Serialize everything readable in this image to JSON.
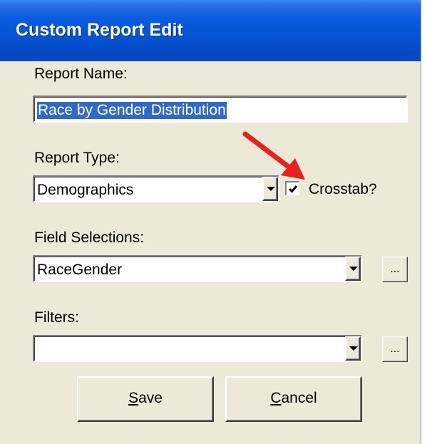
{
  "window": {
    "title": "Custom Report Edit"
  },
  "report_name": {
    "label": "Report Name:",
    "value": "Race by Gender Distribution"
  },
  "report_type": {
    "label": "Report Type:",
    "value": "Demographics"
  },
  "crosstab": {
    "label": "Crosstab?",
    "checked": true
  },
  "field_selections": {
    "label": "Field Selections:",
    "value": "RaceGender",
    "browse_label": "..."
  },
  "filters": {
    "label": "Filters:",
    "value": "",
    "browse_label": "..."
  },
  "buttons": {
    "save": {
      "mnemonic": "S",
      "rest": "ave"
    },
    "cancel": {
      "mnemonic": "C",
      "rest": "ancel"
    }
  },
  "annotation": {
    "arrow_color": "#e82020"
  },
  "colors": {
    "titlebar": "#0654d4",
    "dialog_bg": "#ece9d8",
    "selection": "#316ac5"
  }
}
